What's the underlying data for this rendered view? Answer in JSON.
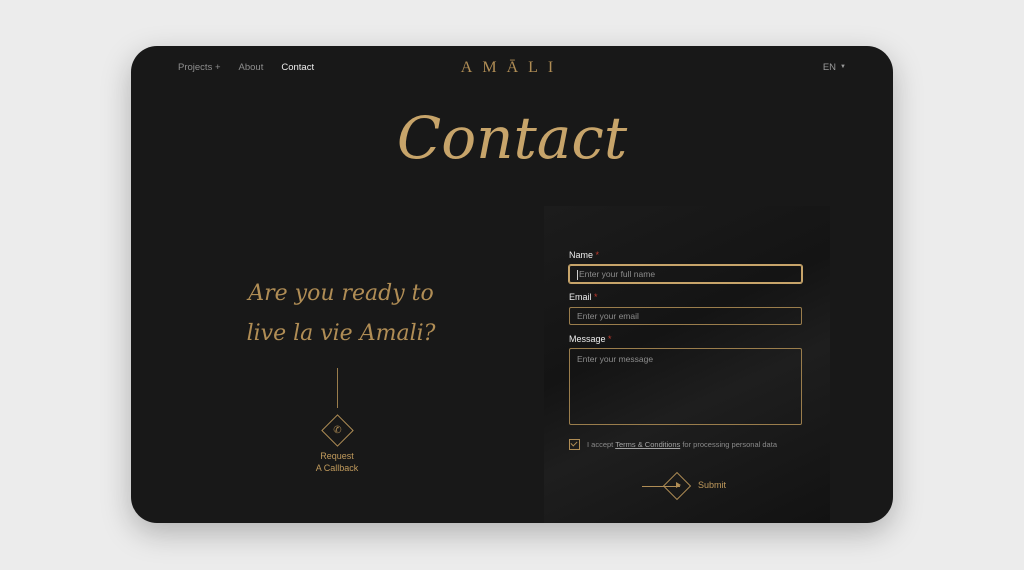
{
  "nav": {
    "items": [
      {
        "label": "Projects +"
      },
      {
        "label": "About"
      },
      {
        "label": "Contact"
      }
    ],
    "logo": "AMĀLI",
    "language": "EN"
  },
  "hero": {
    "title": "Contact"
  },
  "left": {
    "tagline_line1": "Are you ready to",
    "tagline_line2": "live la vie Amali?",
    "callback_line1": "Request",
    "callback_line2": "A Callback"
  },
  "form": {
    "name_label": "Name",
    "name_placeholder": "Enter your full name",
    "email_label": "Email",
    "email_placeholder": "Enter your email",
    "message_label": "Message",
    "message_placeholder": "Enter your message",
    "required_mark": "*",
    "agree_prefix": "I accept",
    "agree_link": "Terms & Conditions",
    "agree_suffix": "for processing personal data",
    "agree_checked": true,
    "submit_label": "Submit"
  },
  "colors": {
    "gold": "#b08d55",
    "background": "#181818",
    "page": "#ececec"
  }
}
